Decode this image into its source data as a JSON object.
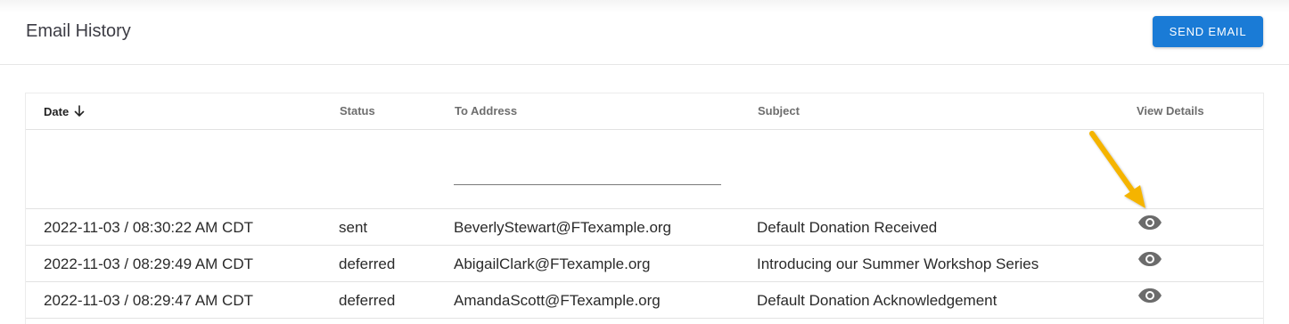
{
  "header": {
    "title": "Email History",
    "send_button_label": "SEND EMAIL",
    "accent_color": "#1a7bd6"
  },
  "table": {
    "columns": {
      "date": "Date",
      "status": "Status",
      "to_address": "To Address",
      "subject": "Subject",
      "view_details": "View Details"
    },
    "sort_icon": "arrow-down-icon",
    "to_address_filter_value": "",
    "rows": [
      {
        "date": "2022-11-03 / 08:30:22 AM CDT",
        "status": "sent",
        "to_address": "BeverlyStewart@FTexample.org",
        "subject": "Default Donation Received",
        "icon": "eye-icon"
      },
      {
        "date": "2022-11-03 / 08:29:49 AM CDT",
        "status": "deferred",
        "to_address": "AbigailClark@FTexample.org",
        "subject": "Introducing our Summer Workshop Series",
        "icon": "eye-icon"
      },
      {
        "date": "2022-11-03 / 08:29:47 AM CDT",
        "status": "deferred",
        "to_address": "AmandaScott@FTexample.org",
        "subject": "Default Donation Acknowledgement",
        "icon": "eye-icon"
      }
    ]
  },
  "annotation": {
    "arrow_color": "#f5b400"
  }
}
